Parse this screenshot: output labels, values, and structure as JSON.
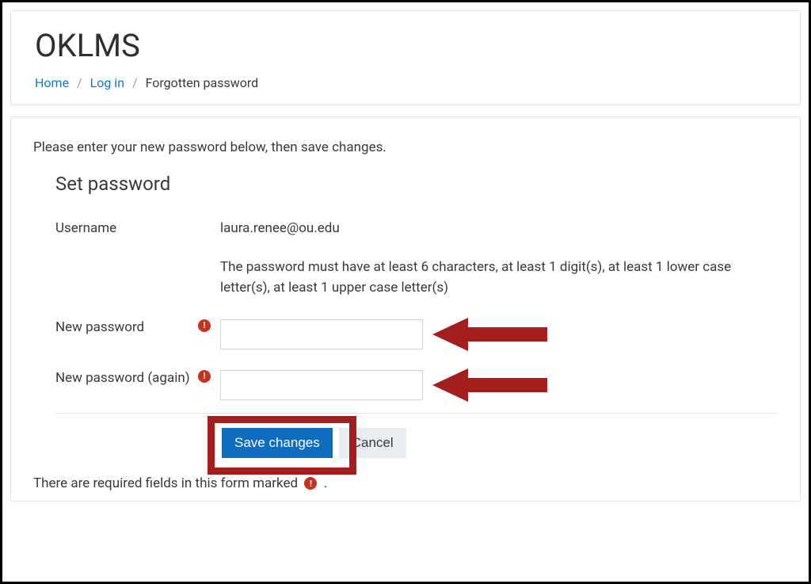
{
  "header": {
    "site_title": "OKLMS",
    "breadcrumb": {
      "home": "Home",
      "login": "Log in",
      "current": "Forgotten password"
    }
  },
  "intro_text": "Please enter your new password below, then save changes.",
  "form": {
    "section_title": "Set password",
    "username_label": "Username",
    "username_value": "laura.renee@ou.edu",
    "password_hint": "The password must have at least 6 characters, at least 1 digit(s), at least 1 lower case letter(s), at least 1 upper case letter(s)",
    "new_password_label": "New password",
    "new_password_again_label": "New password (again)",
    "save_button": "Save changes",
    "cancel_button": "Cancel"
  },
  "footer": {
    "required_note_prefix": "There are required fields in this form marked",
    "required_note_suffix": "."
  },
  "colors": {
    "link": "#1177d1",
    "primary": "#0f6cbf",
    "required": "#ca3120",
    "annotation": "#a41e1e"
  }
}
